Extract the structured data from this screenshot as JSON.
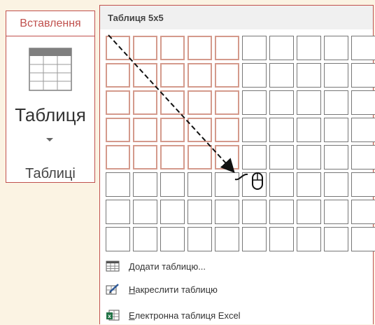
{
  "ribbon": {
    "tab_label": "Вставлення",
    "button_label": "Таблиця",
    "group_label": "Таблиці"
  },
  "panel": {
    "title": "Таблиця 5x5",
    "grid": {
      "columns": 10,
      "rows": 8,
      "selected_columns": 5,
      "selected_rows": 5
    }
  },
  "menu": {
    "items": [
      {
        "icon": "insert-table-icon",
        "label_first": "Д",
        "label_rest": "одати таблицю..."
      },
      {
        "icon": "draw-table-icon",
        "label_first": "Н",
        "label_rest": "акреслити таблицю"
      },
      {
        "icon": "excel-spreadsheet-icon",
        "label_first": "Е",
        "label_rest": "лектронна таблиця Excel"
      }
    ]
  },
  "colors": {
    "accent": "#c0504d",
    "selection_border": "#d49a8c",
    "excel_green": "#217346"
  }
}
